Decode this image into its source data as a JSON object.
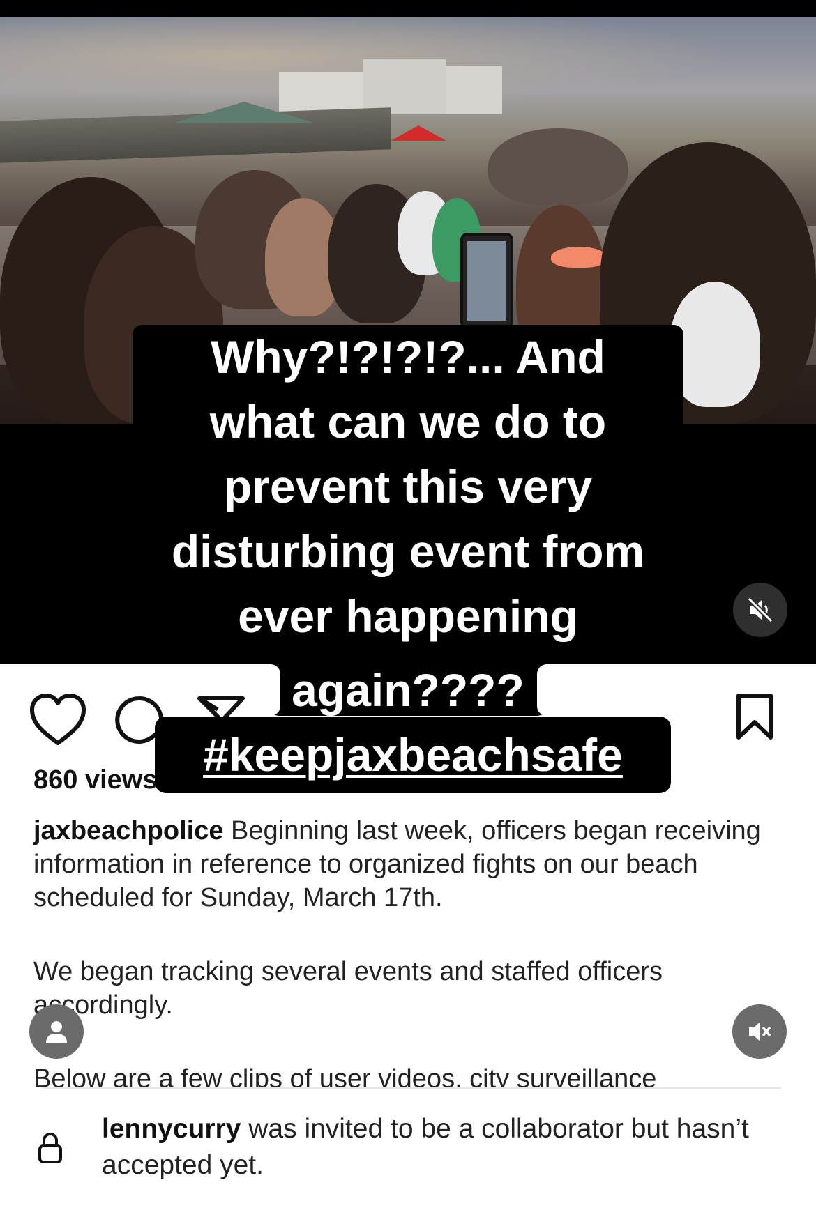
{
  "video": {
    "caption_lines": [
      "Why?!?!?!?... And",
      "what can we do to",
      "prevent this very",
      "disturbing event from",
      "ever happening"
    ],
    "caption_last_line": "again????",
    "hashtag": "#keepjaxbeachsafe",
    "mute_icon": "speaker-muted-icon"
  },
  "actions": {
    "like_icon": "heart-icon",
    "comment_icon": "comment-bubble-icon",
    "share_icon": "paper-plane-icon",
    "save_icon": "bookmark-icon"
  },
  "post": {
    "views": "860 views",
    "username": "jaxbeachpolice",
    "paragraph1": "Beginning last week, officers began receiving information in reference to organized fights on our beach scheduled for Sunday, March 17th.",
    "paragraph2": "We began tracking several events and staffed officers accordingly.",
    "paragraph3": "Below are a few clips of user videos, city surveillance"
  },
  "collab_notice": {
    "icon": "lock-icon",
    "username": "lennycurry",
    "text": "was invited to be a collaborator but hasn’t accepted yet."
  },
  "overlay_buttons": {
    "avatar_icon": "person-icon",
    "mute_icon": "speaker-muted-icon"
  }
}
